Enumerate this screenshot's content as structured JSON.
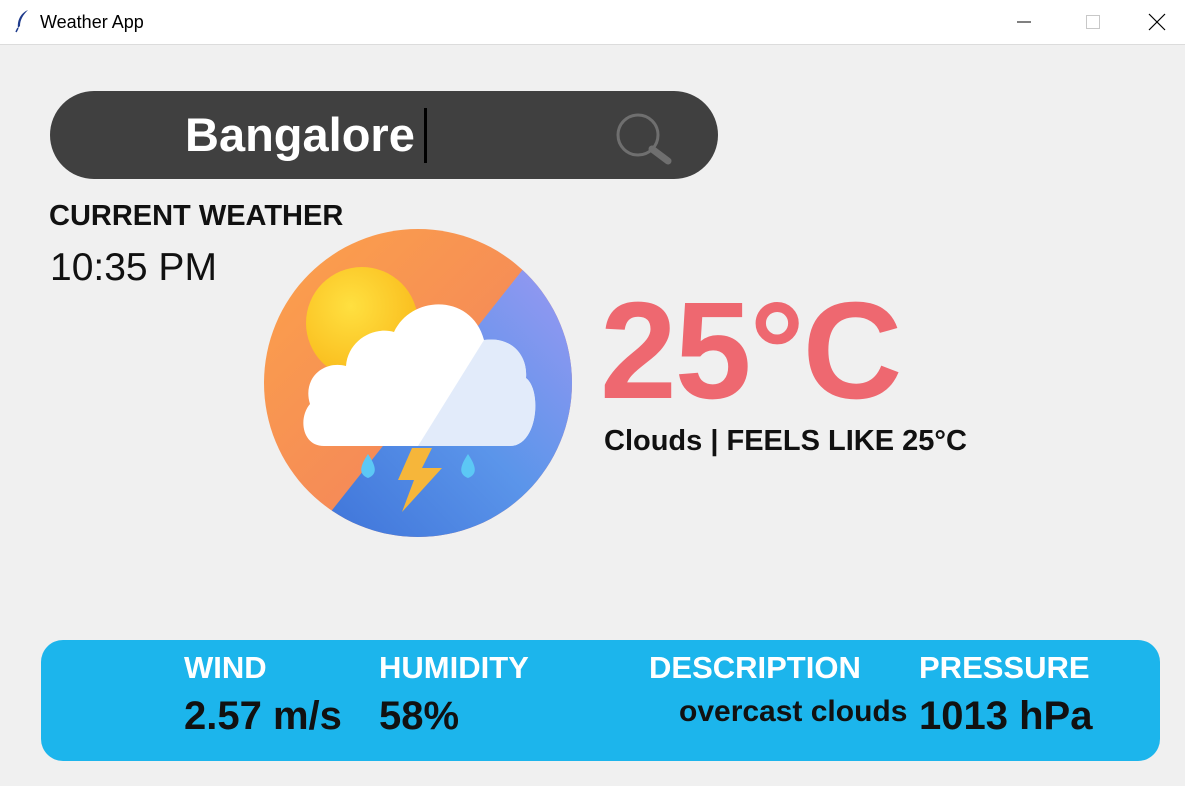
{
  "window": {
    "title": "Weather App"
  },
  "search": {
    "value": "Bangalore"
  },
  "current": {
    "heading": "CURRENT WEATHER",
    "time": "10:35 PM",
    "temperature": "25°C",
    "condition_line": "Clouds | FEELS LIKE 25°C"
  },
  "details": {
    "wind": {
      "label": "WIND",
      "value": "2.57 m/s"
    },
    "humidity": {
      "label": "HUMIDITY",
      "value": "58%"
    },
    "description": {
      "label": "DESCRIPTION",
      "value": "overcast clouds"
    },
    "pressure": {
      "label": "PRESSURE",
      "value": "1013 hPa"
    }
  },
  "colors": {
    "accent_panel": "#1cb5ec",
    "temperature": "#ee6870",
    "search_bar": "#404040"
  },
  "icons": [
    "feather-icon",
    "minimize-icon",
    "maximize-icon",
    "close-icon",
    "search-icon",
    "weather-cloud-sun-storm-icon"
  ]
}
